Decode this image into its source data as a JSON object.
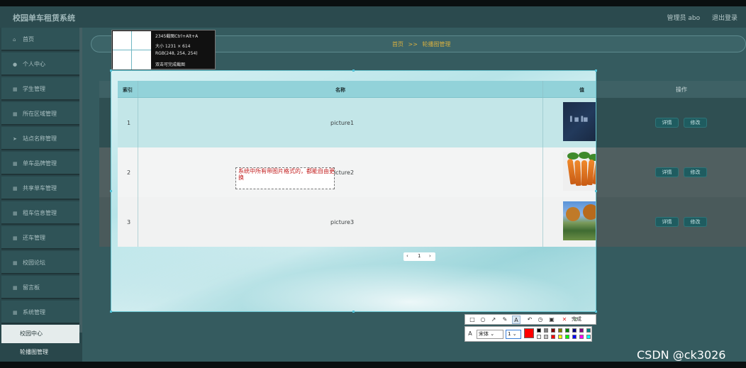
{
  "app": {
    "title": "校园单车租赁系统"
  },
  "header": {
    "user": "管理员 abo",
    "logout": "退出登录"
  },
  "sidebar": {
    "items": [
      {
        "label": "首页",
        "icon": "home-icon"
      },
      {
        "label": "个人中心",
        "icon": "user-icon"
      },
      {
        "label": "学生管理",
        "icon": "grid-icon"
      },
      {
        "label": "所在区域管理",
        "icon": "grid-icon"
      },
      {
        "label": "站点名称管理",
        "icon": "send-icon"
      },
      {
        "label": "单车品牌管理",
        "icon": "grid-icon"
      },
      {
        "label": "共享单车管理",
        "icon": "grid-icon"
      },
      {
        "label": "租车信息管理",
        "icon": "grid-icon"
      },
      {
        "label": "还车管理",
        "icon": "grid-icon"
      },
      {
        "label": "校园论坛",
        "icon": "grid-icon"
      },
      {
        "label": "留言板",
        "icon": "grid-icon"
      },
      {
        "label": "系统管理",
        "icon": "grid-icon"
      }
    ],
    "subitems": [
      {
        "label": "校园中心"
      },
      {
        "label": "轮播图管理"
      }
    ]
  },
  "breadcrumb": {
    "home": "首页",
    "sep": ">>",
    "current": "轮播图管理"
  },
  "table": {
    "headers": {
      "index": "索引",
      "name": "名称",
      "value": "值",
      "actions": "操作"
    },
    "rows": [
      {
        "index": "1",
        "name": "picture1",
        "detail": "详情",
        "edit": "修改"
      },
      {
        "index": "2",
        "name": "picture2",
        "detail": "详情",
        "edit": "修改"
      },
      {
        "index": "3",
        "name": "picture3",
        "detail": "详情",
        "edit": "修改"
      }
    ]
  },
  "pager": {
    "prev": "‹",
    "page": "1",
    "next": "›"
  },
  "annotation": {
    "text": "系统中所有带图片格式的，都能自由更换"
  },
  "magnifier": {
    "line1": "2345截图Ctrl+Alt+A",
    "line2": "大小  1231 × 614",
    "line3": "RGB(248, 254, 254)",
    "line4": "双击可完成截图"
  },
  "toolbar": {
    "done": "完成",
    "font": "宋体",
    "size": "1",
    "current_color": "#ff0000",
    "palette": [
      "#000000",
      "#808080",
      "#800000",
      "#808000",
      "#008000",
      "#000080",
      "#800080",
      "#008080",
      "#ffffff",
      "#c0c0c0",
      "#ff0000",
      "#ffff00",
      "#00ff00",
      "#0000ff",
      "#ff00ff",
      "#00ffff"
    ]
  },
  "watermark": "CSDN @ck3026"
}
